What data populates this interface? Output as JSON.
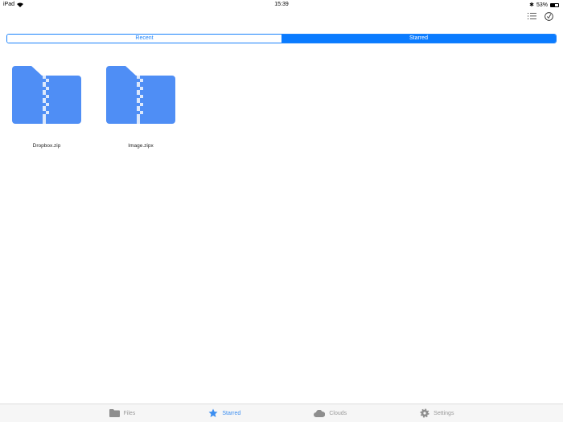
{
  "status": {
    "device": "iPad",
    "time": "15:39",
    "battery": "53%"
  },
  "segments": [
    {
      "label": "Recent",
      "selected": false
    },
    {
      "label": "Starred",
      "selected": true
    }
  ],
  "files": [
    {
      "name": "Dropbox.zip"
    },
    {
      "name": "Image.zipx"
    }
  ],
  "tabs": [
    {
      "label": "Files",
      "icon": "folder-icon"
    },
    {
      "label": "Starred",
      "icon": "star-icon",
      "active": true
    },
    {
      "label": "Clouds",
      "icon": "cloud-icon"
    },
    {
      "label": "Settings",
      "icon": "gear-icon"
    }
  ],
  "colors": {
    "accent": "#0a7bff",
    "folder": "#4f8ef5"
  }
}
